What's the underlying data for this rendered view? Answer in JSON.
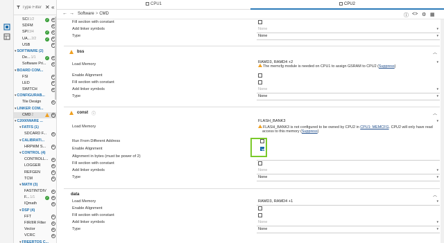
{
  "sidebar": {
    "filter_placeholder": "Type Filter",
    "items": [
      {
        "kind": "leaf",
        "label": "SCI",
        "count": "1/2",
        "status": "ok"
      },
      {
        "kind": "leaf",
        "label": "SDFM",
        "count": "",
        "status": ""
      },
      {
        "kind": "leaf",
        "label": "SPI",
        "count": "3/4",
        "status": "ok"
      },
      {
        "kind": "leaf",
        "label": "UA...",
        "count": "2/2",
        "status": "ok"
      },
      {
        "kind": "leaf",
        "label": "USB",
        "count": "",
        "status": ""
      },
      {
        "kind": "cat",
        "label": "SOFTWARE (2)"
      },
      {
        "kind": "leaf",
        "label": "De...",
        "count": "1/1",
        "status": "ok"
      },
      {
        "kind": "leaf",
        "label": "Software Pri...",
        "count": "",
        "status": ""
      },
      {
        "kind": "cat",
        "label": "BOARD COM..."
      },
      {
        "kind": "leaf",
        "label": "FSI",
        "count": "",
        "status": ""
      },
      {
        "kind": "leaf",
        "label": "LED",
        "count": "",
        "status": ""
      },
      {
        "kind": "leaf",
        "label": "SWITCH",
        "count": "",
        "status": ""
      },
      {
        "kind": "cat",
        "label": "CONFIGURAB..."
      },
      {
        "kind": "leaf",
        "label": "Tile Design",
        "count": "",
        "status": ""
      },
      {
        "kind": "cat",
        "label": "LINKER COM..."
      },
      {
        "kind": "leaf",
        "label": "CMD",
        "count": "2",
        "status": "warn",
        "selected": true
      },
      {
        "kind": "cat",
        "label": "C2000WARE ..."
      },
      {
        "kind": "subcat",
        "label": "FATFS (1)"
      },
      {
        "kind": "subleaf",
        "label": "SDCARD F...",
        "count": "",
        "status": ""
      },
      {
        "kind": "subcat",
        "label": "CALIBRATI..."
      },
      {
        "kind": "subleaf",
        "label": "HRPWM S...",
        "count": "",
        "status": ""
      },
      {
        "kind": "subcat",
        "label": "CONTROL (4)"
      },
      {
        "kind": "subleaf",
        "label": "CONTROLL...",
        "count": "",
        "status": ""
      },
      {
        "kind": "subleaf",
        "label": "LOGGER",
        "count": "",
        "status": ""
      },
      {
        "kind": "subleaf",
        "label": "REFGEN",
        "count": "",
        "status": ""
      },
      {
        "kind": "subleaf",
        "label": "TCM",
        "count": "",
        "status": ""
      },
      {
        "kind": "subcat",
        "label": "MATH (3)"
      },
      {
        "kind": "subleaf",
        "label": "FASTINTDIV",
        "count": "",
        "status": ""
      },
      {
        "kind": "subleaf",
        "label": "F...",
        "count": "1/1",
        "status": "ok"
      },
      {
        "kind": "subleaf",
        "label": "IQmath",
        "count": "",
        "status": ""
      },
      {
        "kind": "subcat",
        "label": "DSP (4)"
      },
      {
        "kind": "subleaf",
        "label": "FFT",
        "count": "",
        "status": ""
      },
      {
        "kind": "subleaf",
        "label": "FIR/IIR Filter",
        "count": "",
        "status": ""
      },
      {
        "kind": "subleaf",
        "label": "Vector",
        "count": "",
        "status": ""
      },
      {
        "kind": "subleaf",
        "label": "VCRC",
        "count": "",
        "status": ""
      },
      {
        "kind": "subcat",
        "label": "FREERTOS C..."
      }
    ]
  },
  "tabs": {
    "cpu1": "CPU1",
    "cpu2": "CPU2"
  },
  "breadcrumb": {
    "part1": "Software",
    "sep": ">",
    "part2": "CMD"
  },
  "content": {
    "top": {
      "fill_label": "Fill section with constant",
      "linker_label": "Add linker symbols",
      "linker_value": "None",
      "type_label": "Type",
      "type_value": "None"
    },
    "bss": {
      "title": "bss",
      "load_label": "Load Memory",
      "load_value": "RAMD3, RAMD4 +2",
      "note_pre": "The memcfg module is needed on CPU1 to assign GSRAM to CPU2 (",
      "note_link": "Suppress",
      "note_post": ")",
      "align_label": "Enable Alignment",
      "fill_label": "Fill section with constant",
      "linker_label": "Add linker symbols",
      "linker_value": "None",
      "type_label": "Type",
      "type_value": "None"
    },
    "const": {
      "title": "const",
      "load_label": "Load Memory",
      "load_value": "FLASH_BANK3",
      "note_pre": "FLASH_BANK3 is not configured to be owned by CPU2 in ",
      "note_link1": "CPU1: MEMCFG",
      "note_mid": ". CPU2 will only have read",
      "note_line2_pre": "access to this memory (",
      "note_link2": "Suppress",
      "note_line2_post": ")",
      "run_label": "Run From Different Address",
      "align_label": "Enable Alignment",
      "align_bytes_label": "Alignment in bytes (must be power of 2)",
      "fill_label": "Fill section with constant",
      "linker_label": "Add linker symbols",
      "linker_value": "None",
      "type_label": "Type",
      "type_value": "None"
    },
    "data": {
      "title": "data",
      "load_label": "Load Memory",
      "load_value": "RAMD3, RAMD4 +1",
      "align_label": "Enable Alignment",
      "fill_label": "Fill section with constant",
      "linker_label": "Add linker symbols",
      "linker_value": "None",
      "type_label": "Type",
      "type_value": "None"
    }
  },
  "colors": {
    "accent": "#2b7ab8",
    "warn": "#f0a020",
    "ok": "#3a9f3a",
    "highlight": "#7ac92a"
  }
}
